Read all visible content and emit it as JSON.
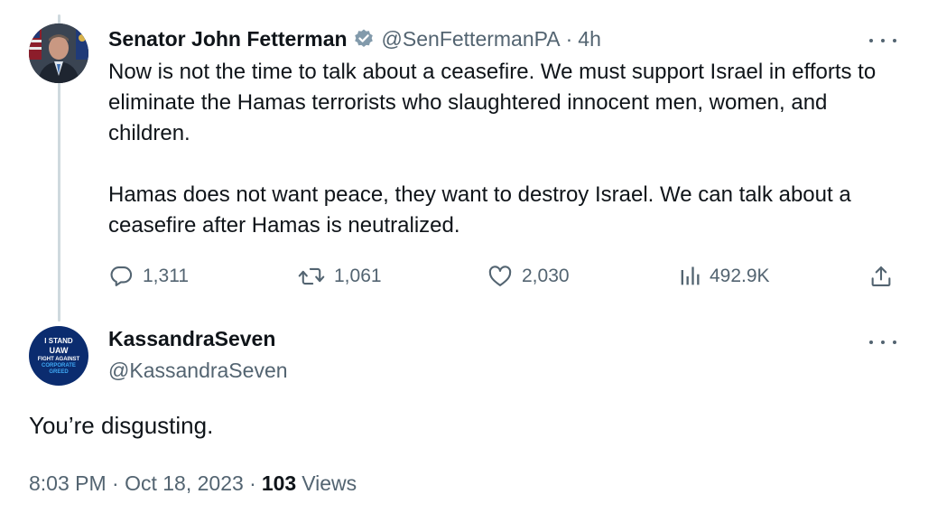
{
  "tweet": {
    "author_name": "Senator John Fetterman",
    "handle": "@SenFettermanPA",
    "separator": "·",
    "time": "4h",
    "text_paragraphs": [
      "Now is not the time to talk about a ceasefire. We must support Israel in efforts to eliminate the Hamas terrorists who slaughtered innocent men, women, and children.",
      "Hamas does not want peace, they want to destroy Israel. We can talk about a ceasefire after Hamas is neutralized."
    ],
    "actions": {
      "replies": "1,311",
      "reposts": "1,061",
      "likes": "2,030",
      "views": "492.9K"
    },
    "verified_badge_color": "#829aab"
  },
  "reply": {
    "author_name": "KassandraSeven",
    "handle": "@KassandraSeven",
    "avatar_text": {
      "line1": "I STAND",
      "line2": "UAW",
      "line3": "FIGHT AGAINST",
      "line4": "CORPORATE",
      "line5": "GREED"
    },
    "text": "You’re disgusting.",
    "timestamp": "8:03 PM · Oct 18, 2023 ·",
    "views_count": "103",
    "views_label": "Views"
  },
  "colors": {
    "text_primary": "#0f1419",
    "text_secondary": "#536471",
    "thread_line": "#cfd9de"
  },
  "icons": [
    "reply-icon",
    "repost-icon",
    "like-icon",
    "views-icon",
    "share-icon",
    "more-icon",
    "verified-badge-icon"
  ]
}
